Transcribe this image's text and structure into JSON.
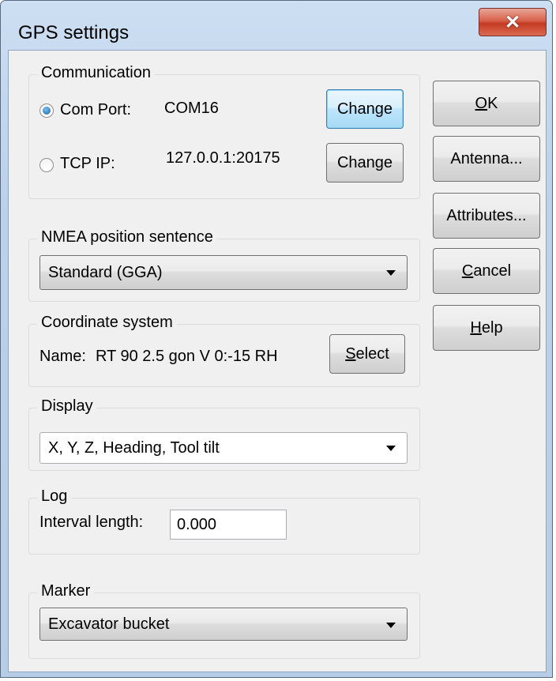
{
  "window": {
    "title": "GPS settings",
    "close_glyph": "✕"
  },
  "communication": {
    "legend": "Communication",
    "com_port_label": "Com Port:",
    "com_port_value": "COM16",
    "com_port_selected": true,
    "tcp_ip_label": "TCP IP:",
    "tcp_ip_value": "127.0.0.1:20175",
    "change_label_1": "Change",
    "change_label_2": "Change"
  },
  "nmea": {
    "legend": "NMEA position sentence",
    "selected": "Standard (GGA)"
  },
  "coordinate_system": {
    "legend": "Coordinate system",
    "name_label": "Name:",
    "name_value": "RT 90 2.5 gon V 0:-15 RH",
    "select_rest": "elect",
    "select_mnemonic": "S"
  },
  "display": {
    "legend": "Display",
    "selected": "X, Y, Z, Heading, Tool tilt"
  },
  "log": {
    "legend": "Log",
    "interval_label": "Interval length:",
    "interval_value": "0.000"
  },
  "marker": {
    "legend": "Marker",
    "selected": "Excavator bucket"
  },
  "side_buttons": {
    "ok_mnemonic": "O",
    "ok_rest": "K",
    "antenna": "Antenna...",
    "attributes": "Attributes...",
    "cancel_mnemonic": "C",
    "cancel_rest": "ancel",
    "help_mnemonic": "H",
    "help_rest": "elp"
  },
  "icons": {
    "close": "close-icon",
    "dropdown": "chevron-down-icon"
  }
}
